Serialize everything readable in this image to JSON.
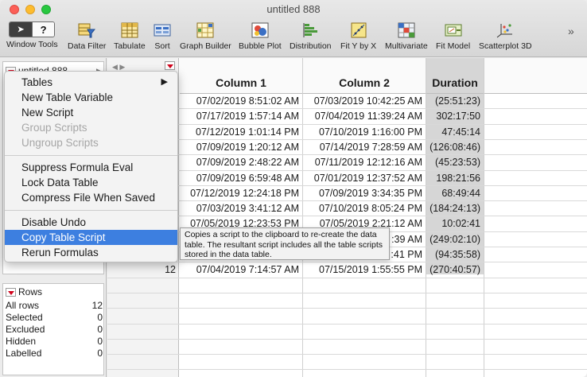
{
  "window": {
    "title": "untitled 888"
  },
  "toolbar": {
    "items": [
      {
        "label": "Window Tools",
        "icon": "window-tools-icon"
      },
      {
        "label": "Data Filter",
        "icon": "data-filter-icon"
      },
      {
        "label": "Tabulate",
        "icon": "tabulate-icon"
      },
      {
        "label": "Sort",
        "icon": "sort-icon"
      },
      {
        "label": "Graph Builder",
        "icon": "graph-builder-icon"
      },
      {
        "label": "Bubble Plot",
        "icon": "bubble-plot-icon"
      },
      {
        "label": "Distribution",
        "icon": "distribution-icon"
      },
      {
        "label": "Fit Y by X",
        "icon": "fit-y-by-x-icon"
      },
      {
        "label": "Multivariate",
        "icon": "multivariate-icon"
      },
      {
        "label": "Fit Model",
        "icon": "fit-model-icon"
      },
      {
        "label": "Scatterplot 3D",
        "icon": "scatterplot-3d-icon"
      }
    ],
    "window_tools_arrow": "➤",
    "window_tools_help": "?",
    "overflow": "»"
  },
  "table_panel": {
    "name": "untitled 888"
  },
  "rows_panel": {
    "title": "Rows",
    "rows": [
      {
        "label": "All rows",
        "value": "12"
      },
      {
        "label": "Selected",
        "value": "0"
      },
      {
        "label": "Excluded",
        "value": "0"
      },
      {
        "label": "Hidden",
        "value": "0"
      },
      {
        "label": "Labelled",
        "value": "0"
      }
    ]
  },
  "grid": {
    "columns": [
      "Column 1",
      "Column 2",
      "Duration"
    ],
    "visible_row_numbers": [
      {
        "row": 12
      }
    ],
    "rows": [
      [
        "07/02/2019 8:51:02 AM",
        "07/03/2019 10:42:25 AM",
        "(25:51:23)"
      ],
      [
        "07/17/2019 1:57:14 AM",
        "07/04/2019 11:39:24 AM",
        "302:17:50"
      ],
      [
        "07/12/2019 1:01:14 PM",
        "07/10/2019 1:16:00 PM",
        "47:45:14"
      ],
      [
        "07/09/2019 1:20:12 AM",
        "07/14/2019 7:28:59 AM",
        "(126:08:46)"
      ],
      [
        "07/09/2019 2:48:22 AM",
        "07/11/2019 12:12:16 AM",
        "(45:23:53)"
      ],
      [
        "07/09/2019 6:59:48 AM",
        "07/01/2019 12:37:52 AM",
        "198:21:56"
      ],
      [
        "07/12/2019 12:24:18 PM",
        "07/09/2019 3:34:35 PM",
        "68:49:44"
      ],
      [
        "07/03/2019 3:41:12 AM",
        "07/10/2019 8:05:24 PM",
        "(184:24:13)"
      ],
      [
        "07/05/2019 12:23:53 PM",
        "07/05/2019 2:21:12 AM",
        "10:02:41"
      ],
      [
        "",
        ":39 AM",
        "(249:02:10)"
      ],
      [
        "",
        ":41 PM",
        "(94:35:58)"
      ],
      [
        "07/04/2019 7:14:57 AM",
        "07/15/2019 1:55:55 PM",
        "(270:40:57)"
      ]
    ]
  },
  "context_menu": {
    "items": [
      {
        "label": "Tables",
        "enabled": true,
        "submenu": "▶"
      },
      {
        "label": "New Table Variable",
        "enabled": true
      },
      {
        "label": "New Script",
        "enabled": true
      },
      {
        "label": "Group Scripts",
        "enabled": false
      },
      {
        "label": "Ungroup Scripts",
        "enabled": false
      },
      {
        "label": "Suppress Formula Eval",
        "enabled": true
      },
      {
        "label": "Lock Data Table",
        "enabled": true
      },
      {
        "label": "Compress File When Saved",
        "enabled": true
      },
      {
        "label": "Disable Undo",
        "enabled": true
      },
      {
        "label": "Copy Table Script",
        "enabled": true,
        "selected": true
      },
      {
        "label": "Rerun Formulas",
        "enabled": true
      }
    ]
  },
  "tooltip": {
    "text": "Copies a script to the clipboard to re-create the data table. The resultant script includes all the table scripts stored in the data table."
  },
  "colors": {
    "selection": "#3d7fe0",
    "red_triangle": "#d0021b",
    "duration_column": "#d6d6d6"
  }
}
